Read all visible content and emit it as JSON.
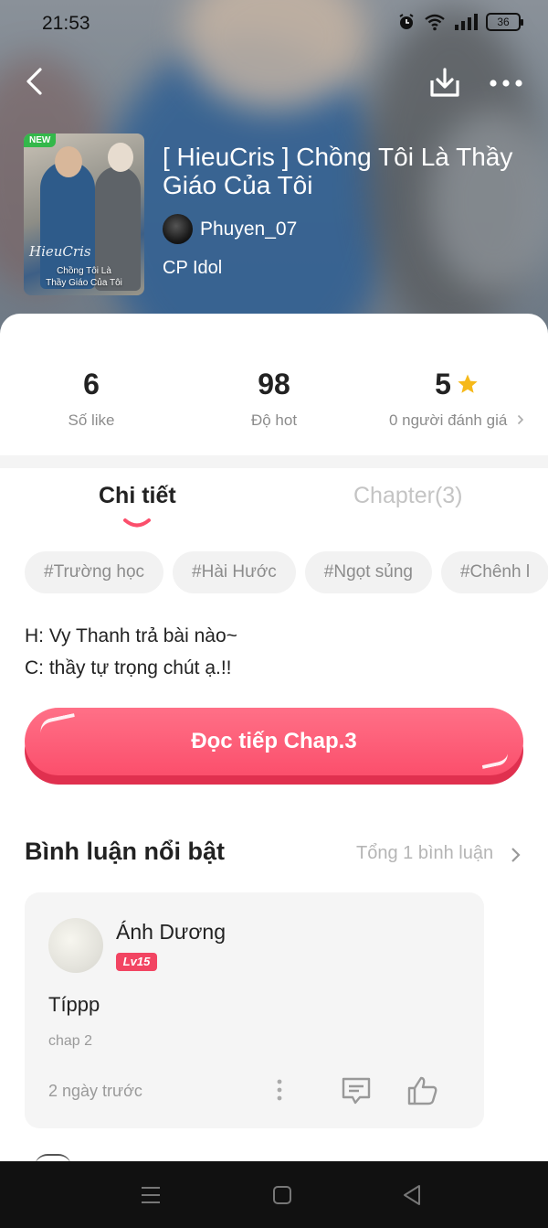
{
  "status_bar": {
    "time": "21:53",
    "battery": "36"
  },
  "header": {
    "back_icon": "chevron-left-icon",
    "download_icon": "download-icon",
    "more_icon": "more-horizontal-icon"
  },
  "story": {
    "cover_badge": "NEW",
    "cover_script": "HieuCris",
    "cover_caption_line1": "Chồng Tôi Là",
    "cover_caption_line2": "Thầy Giáo Của Tôi",
    "title": "[ HieuCris ] Chồng Tôi Là Thầy Giáo Của Tôi",
    "author": "Phuyen_07",
    "category": "CP Idol"
  },
  "stats": {
    "likes_value": "6",
    "likes_label": "Số like",
    "hot_value": "98",
    "hot_label": "Độ hot",
    "rating_value": "5",
    "rating_label": "0 người đánh giá"
  },
  "tabs": {
    "detail": "Chi tiết",
    "chapter": "Chapter(3)"
  },
  "tags": [
    "#Trường học",
    "#Hài Hước",
    "#Ngọt sủng",
    "#Chênh l"
  ],
  "description": {
    "line1": "H: Vy Thanh trả bài nào~",
    "line2": "C: thầy tự trọng chút ạ.!!"
  },
  "read_button": {
    "label": "Đọc tiếp Chap.3"
  },
  "comments_section": {
    "title": "Bình luận nổi bật",
    "total": "Tổng 1 bình luận",
    "comment": {
      "name": "Ánh Dương",
      "level": "Lv15",
      "text": "Típpp",
      "chapter": "chap 2",
      "time": "2 ngày trước"
    }
  },
  "colors": {
    "accent": "#fb4f6c",
    "star": "#f6b91a",
    "tag_bg": "#f2f2f2",
    "nav_bg": "#111111"
  }
}
